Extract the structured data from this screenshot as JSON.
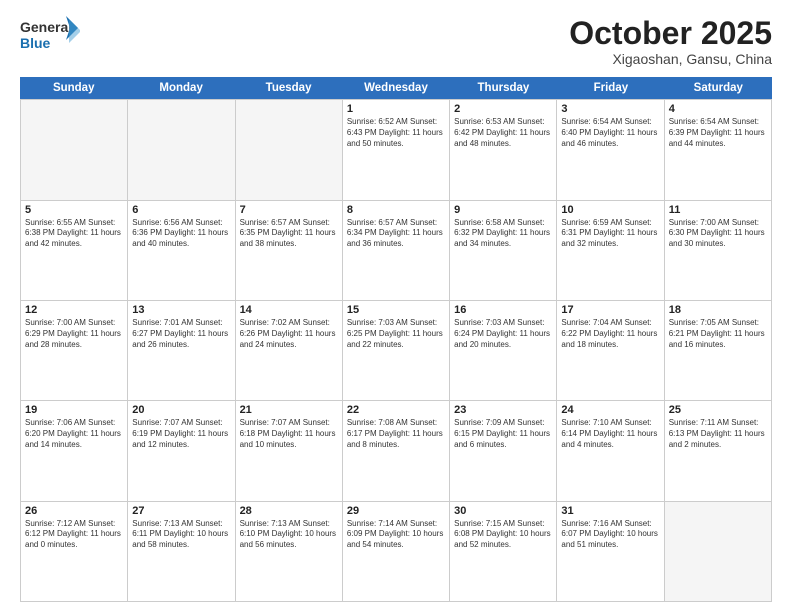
{
  "logo": {
    "line1": "General",
    "line2": "Blue"
  },
  "title": "October 2025",
  "subtitle": "Xigaoshan, Gansu, China",
  "weekdays": [
    "Sunday",
    "Monday",
    "Tuesday",
    "Wednesday",
    "Thursday",
    "Friday",
    "Saturday"
  ],
  "rows": [
    [
      {
        "day": "",
        "info": "",
        "empty": true
      },
      {
        "day": "",
        "info": "",
        "empty": true
      },
      {
        "day": "",
        "info": "",
        "empty": true
      },
      {
        "day": "1",
        "info": "Sunrise: 6:52 AM\nSunset: 6:43 PM\nDaylight: 11 hours\nand 50 minutes.",
        "empty": false
      },
      {
        "day": "2",
        "info": "Sunrise: 6:53 AM\nSunset: 6:42 PM\nDaylight: 11 hours\nand 48 minutes.",
        "empty": false
      },
      {
        "day": "3",
        "info": "Sunrise: 6:54 AM\nSunset: 6:40 PM\nDaylight: 11 hours\nand 46 minutes.",
        "empty": false
      },
      {
        "day": "4",
        "info": "Sunrise: 6:54 AM\nSunset: 6:39 PM\nDaylight: 11 hours\nand 44 minutes.",
        "empty": false
      }
    ],
    [
      {
        "day": "5",
        "info": "Sunrise: 6:55 AM\nSunset: 6:38 PM\nDaylight: 11 hours\nand 42 minutes.",
        "empty": false
      },
      {
        "day": "6",
        "info": "Sunrise: 6:56 AM\nSunset: 6:36 PM\nDaylight: 11 hours\nand 40 minutes.",
        "empty": false
      },
      {
        "day": "7",
        "info": "Sunrise: 6:57 AM\nSunset: 6:35 PM\nDaylight: 11 hours\nand 38 minutes.",
        "empty": false
      },
      {
        "day": "8",
        "info": "Sunrise: 6:57 AM\nSunset: 6:34 PM\nDaylight: 11 hours\nand 36 minutes.",
        "empty": false
      },
      {
        "day": "9",
        "info": "Sunrise: 6:58 AM\nSunset: 6:32 PM\nDaylight: 11 hours\nand 34 minutes.",
        "empty": false
      },
      {
        "day": "10",
        "info": "Sunrise: 6:59 AM\nSunset: 6:31 PM\nDaylight: 11 hours\nand 32 minutes.",
        "empty": false
      },
      {
        "day": "11",
        "info": "Sunrise: 7:00 AM\nSunset: 6:30 PM\nDaylight: 11 hours\nand 30 minutes.",
        "empty": false
      }
    ],
    [
      {
        "day": "12",
        "info": "Sunrise: 7:00 AM\nSunset: 6:29 PM\nDaylight: 11 hours\nand 28 minutes.",
        "empty": false
      },
      {
        "day": "13",
        "info": "Sunrise: 7:01 AM\nSunset: 6:27 PM\nDaylight: 11 hours\nand 26 minutes.",
        "empty": false
      },
      {
        "day": "14",
        "info": "Sunrise: 7:02 AM\nSunset: 6:26 PM\nDaylight: 11 hours\nand 24 minutes.",
        "empty": false
      },
      {
        "day": "15",
        "info": "Sunrise: 7:03 AM\nSunset: 6:25 PM\nDaylight: 11 hours\nand 22 minutes.",
        "empty": false
      },
      {
        "day": "16",
        "info": "Sunrise: 7:03 AM\nSunset: 6:24 PM\nDaylight: 11 hours\nand 20 minutes.",
        "empty": false
      },
      {
        "day": "17",
        "info": "Sunrise: 7:04 AM\nSunset: 6:22 PM\nDaylight: 11 hours\nand 18 minutes.",
        "empty": false
      },
      {
        "day": "18",
        "info": "Sunrise: 7:05 AM\nSunset: 6:21 PM\nDaylight: 11 hours\nand 16 minutes.",
        "empty": false
      }
    ],
    [
      {
        "day": "19",
        "info": "Sunrise: 7:06 AM\nSunset: 6:20 PM\nDaylight: 11 hours\nand 14 minutes.",
        "empty": false
      },
      {
        "day": "20",
        "info": "Sunrise: 7:07 AM\nSunset: 6:19 PM\nDaylight: 11 hours\nand 12 minutes.",
        "empty": false
      },
      {
        "day": "21",
        "info": "Sunrise: 7:07 AM\nSunset: 6:18 PM\nDaylight: 11 hours\nand 10 minutes.",
        "empty": false
      },
      {
        "day": "22",
        "info": "Sunrise: 7:08 AM\nSunset: 6:17 PM\nDaylight: 11 hours\nand 8 minutes.",
        "empty": false
      },
      {
        "day": "23",
        "info": "Sunrise: 7:09 AM\nSunset: 6:15 PM\nDaylight: 11 hours\nand 6 minutes.",
        "empty": false
      },
      {
        "day": "24",
        "info": "Sunrise: 7:10 AM\nSunset: 6:14 PM\nDaylight: 11 hours\nand 4 minutes.",
        "empty": false
      },
      {
        "day": "25",
        "info": "Sunrise: 7:11 AM\nSunset: 6:13 PM\nDaylight: 11 hours\nand 2 minutes.",
        "empty": false
      }
    ],
    [
      {
        "day": "26",
        "info": "Sunrise: 7:12 AM\nSunset: 6:12 PM\nDaylight: 11 hours\nand 0 minutes.",
        "empty": false
      },
      {
        "day": "27",
        "info": "Sunrise: 7:13 AM\nSunset: 6:11 PM\nDaylight: 10 hours\nand 58 minutes.",
        "empty": false
      },
      {
        "day": "28",
        "info": "Sunrise: 7:13 AM\nSunset: 6:10 PM\nDaylight: 10 hours\nand 56 minutes.",
        "empty": false
      },
      {
        "day": "29",
        "info": "Sunrise: 7:14 AM\nSunset: 6:09 PM\nDaylight: 10 hours\nand 54 minutes.",
        "empty": false
      },
      {
        "day": "30",
        "info": "Sunrise: 7:15 AM\nSunset: 6:08 PM\nDaylight: 10 hours\nand 52 minutes.",
        "empty": false
      },
      {
        "day": "31",
        "info": "Sunrise: 7:16 AM\nSunset: 6:07 PM\nDaylight: 10 hours\nand 51 minutes.",
        "empty": false
      },
      {
        "day": "",
        "info": "",
        "empty": true
      }
    ]
  ]
}
